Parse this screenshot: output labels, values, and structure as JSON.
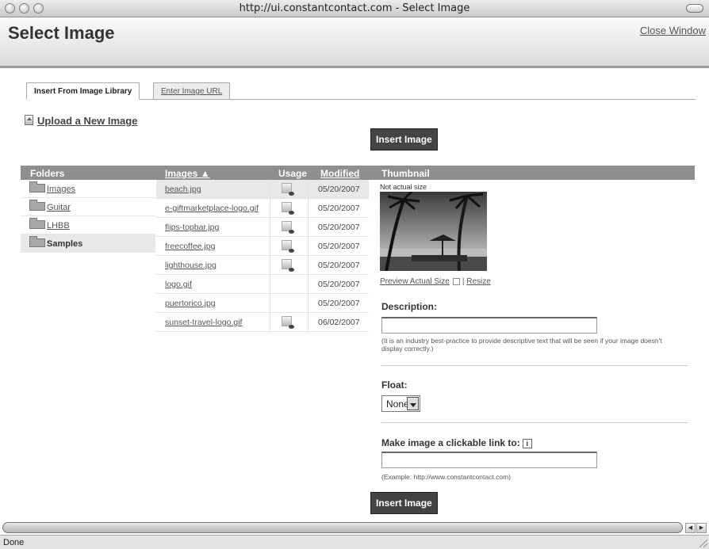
{
  "window": {
    "title": "http://ui.constantcontact.com - Select Image"
  },
  "header": {
    "title": "Select Image",
    "close_label": "Close Window"
  },
  "tabs": [
    {
      "label": "Insert From Image Library",
      "active": true
    },
    {
      "label": "Enter Image URL",
      "active": false
    }
  ],
  "upload": {
    "label": "Upload a New Image"
  },
  "insert_button": {
    "label": "Insert Image"
  },
  "table": {
    "headers": {
      "folders": "Folders",
      "images": "Images ▲",
      "usage": "Usage",
      "modified": "Modified",
      "thumbnail": "Thumbnail"
    }
  },
  "folders": [
    {
      "label": "Images",
      "selected": false
    },
    {
      "label": "Guitar",
      "selected": false
    },
    {
      "label": "LHBB",
      "selected": false
    },
    {
      "label": "Samples",
      "selected": true
    }
  ],
  "images": [
    {
      "name": "beach.jpg",
      "used": true,
      "date": "05/20/2007"
    },
    {
      "name": "e-giftmarketplace-logo.gif",
      "used": true,
      "date": "05/20/2007"
    },
    {
      "name": "flips-topbar.jpg",
      "used": true,
      "date": "05/20/2007"
    },
    {
      "name": "freecoffee.jpg",
      "used": true,
      "date": "05/20/2007"
    },
    {
      "name": "lighthouse.jpg",
      "used": true,
      "date": "05/20/2007"
    },
    {
      "name": "logo.gif",
      "used": false,
      "date": "05/20/2007"
    },
    {
      "name": "puertorico.jpg",
      "used": false,
      "date": "05/20/2007"
    },
    {
      "name": "sunset-travel-logo.gif",
      "used": true,
      "date": "06/02/2007"
    }
  ],
  "thumbnail": {
    "caption": "Not actual size",
    "preview_label": "Preview Actual Size",
    "separator": "|",
    "resize_label": "Resize"
  },
  "description": {
    "label": "Description:",
    "value": "",
    "hint": "(It is an industry best-practice to provide descriptive text that will be seen if your image doesn't display correctly.)"
  },
  "float": {
    "label": "Float:",
    "selected": "None"
  },
  "link": {
    "label": "Make image a clickable link to:",
    "info_icon": "i",
    "value": "",
    "hint": "(Example: http://www.constantcontact.com)"
  },
  "statusbar": {
    "text": "Done"
  },
  "colors": {
    "header_bar": "#8e8e8e",
    "button": "#444444",
    "selected_row": "#e8e8e8"
  }
}
